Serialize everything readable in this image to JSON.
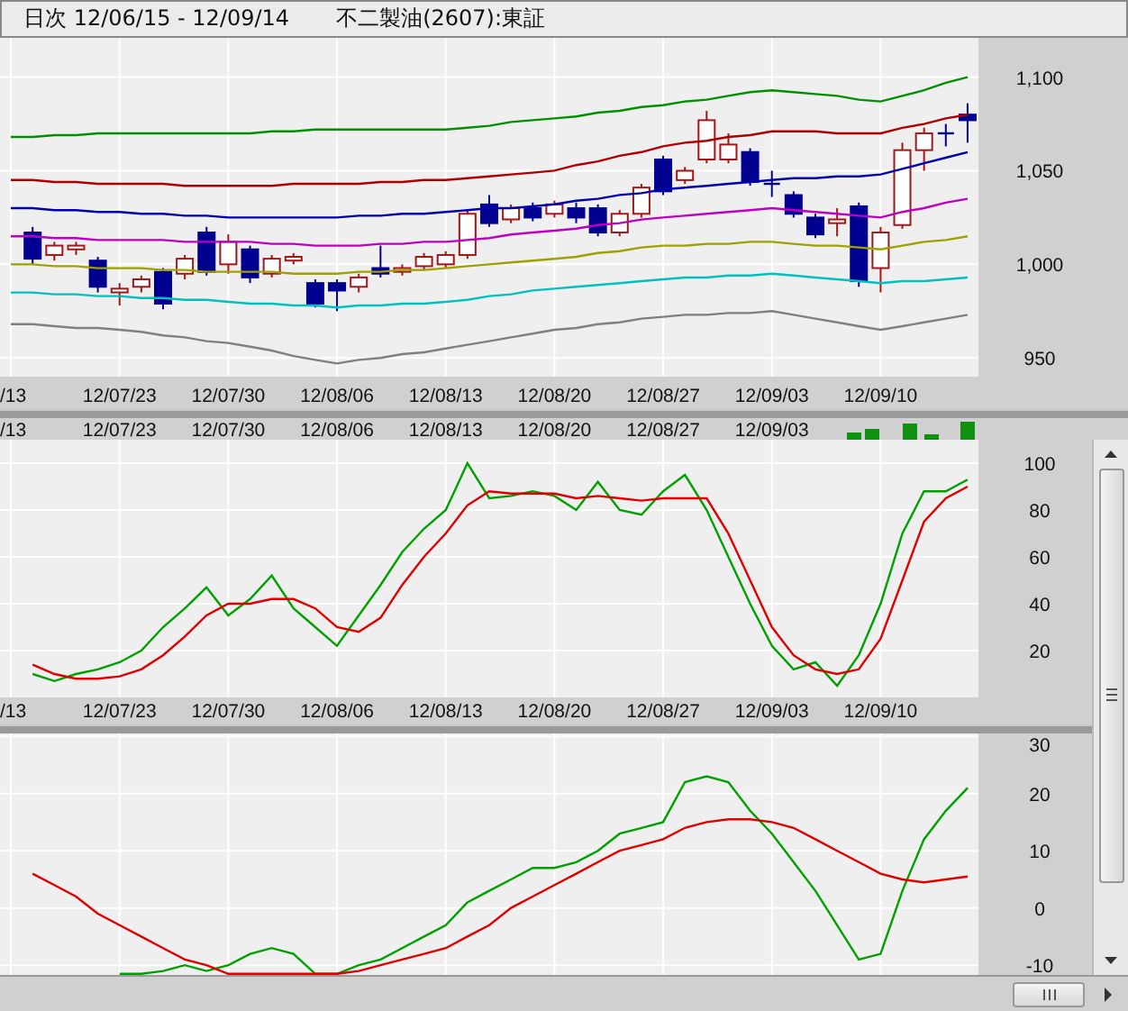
{
  "header": {
    "period": "日次 12/06/15 - 12/09/14",
    "security": "不二製油(2607):東証"
  },
  "price_panel": {
    "chart_data": {
      "type": "candlestick",
      "grid": true,
      "categories": [
        "/13",
        null,
        null,
        null,
        null,
        "12/07/23",
        null,
        null,
        null,
        null,
        "12/07/30",
        null,
        null,
        null,
        null,
        "12/08/06",
        null,
        null,
        null,
        null,
        "12/08/13",
        null,
        null,
        null,
        null,
        "12/08/20",
        null,
        null,
        null,
        null,
        "12/08/27",
        null,
        null,
        null,
        null,
        "12/09/03",
        null,
        null,
        null,
        null,
        "12/09/10",
        null,
        null,
        null,
        null
      ],
      "ylim": [
        940,
        1121
      ],
      "yticks": [
        {
          "value": 1100,
          "label": "1,100"
        },
        {
          "value": 1050,
          "label": "1,050"
        },
        {
          "value": 1000,
          "label": "1,000"
        },
        {
          "value": 950,
          "label": "950"
        }
      ],
      "ohlc": [
        null,
        [
          1017,
          1020,
          1000,
          1003
        ],
        [
          1005,
          1012,
          1002,
          1010
        ],
        [
          1008,
          1012,
          1005,
          1010
        ],
        [
          1002,
          1004,
          985,
          988
        ],
        [
          985,
          990,
          978,
          987
        ],
        [
          988,
          994,
          985,
          992
        ],
        [
          996,
          998,
          976,
          979
        ],
        [
          995,
          1005,
          992,
          1003
        ],
        [
          1017,
          1020,
          994,
          996
        ],
        [
          1000,
          1016,
          995,
          1012
        ],
        [
          1008,
          1010,
          990,
          993
        ],
        [
          995,
          1005,
          993,
          1003
        ],
        [
          1002,
          1006,
          1000,
          1004
        ],
        [
          990,
          992,
          977,
          979
        ],
        [
          990,
          992,
          975,
          986
        ],
        [
          988,
          995,
          985,
          993
        ],
        [
          998,
          1010,
          993,
          995
        ],
        [
          996,
          1000,
          994,
          998
        ],
        [
          999,
          1006,
          997,
          1004
        ],
        [
          1000,
          1007,
          998,
          1005
        ],
        [
          1005,
          1029,
          1003,
          1027
        ],
        [
          1032,
          1037,
          1020,
          1022
        ],
        [
          1024,
          1032,
          1022,
          1030
        ],
        [
          1030,
          1033,
          1023,
          1025
        ],
        [
          1027,
          1034,
          1025,
          1032
        ],
        [
          1030,
          1033,
          1022,
          1025
        ],
        [
          1030,
          1032,
          1015,
          1017
        ],
        [
          1017,
          1029,
          1015,
          1027
        ],
        [
          1027,
          1043,
          1025,
          1041
        ],
        [
          1056,
          1058,
          1037,
          1039
        ],
        [
          1045,
          1052,
          1043,
          1050
        ],
        [
          1056,
          1082,
          1054,
          1077
        ],
        [
          1056,
          1070,
          1054,
          1064
        ],
        [
          1060,
          1062,
          1042,
          1044
        ],
        [
          1043,
          1050,
          1036,
          1043
        ],
        [
          1037,
          1039,
          1025,
          1027
        ],
        [
          1025,
          1027,
          1014,
          1016
        ],
        [
          1022,
          1030,
          1015,
          1024
        ],
        [
          1031,
          1033,
          988,
          991
        ],
        [
          998,
          1020,
          985,
          1017
        ],
        [
          1021,
          1065,
          1019,
          1061
        ],
        [
          1061,
          1073,
          1050,
          1070
        ],
        [
          1070,
          1075,
          1063,
          1070
        ],
        [
          1080,
          1086,
          1065,
          1077
        ]
      ],
      "series": [
        {
          "type": "line",
          "color": "#009000",
          "values": [
            1068,
            1068,
            1069,
            1069,
            1070,
            1070,
            1070,
            1070,
            1070,
            1070,
            1070,
            1070,
            1071,
            1071,
            1072,
            1072,
            1072,
            1072,
            1072,
            1072,
            1072,
            1073,
            1074,
            1076,
            1077,
            1078,
            1079,
            1081,
            1082,
            1084,
            1085,
            1087,
            1088,
            1090,
            1092,
            1093,
            1092,
            1091,
            1090,
            1088,
            1087,
            1090,
            1093,
            1097,
            1100
          ]
        },
        {
          "type": "line",
          "color": "#b00000",
          "values": [
            1045,
            1045,
            1044,
            1044,
            1043,
            1043,
            1043,
            1043,
            1042,
            1042,
            1042,
            1042,
            1042,
            1043,
            1043,
            1043,
            1043,
            1044,
            1044,
            1045,
            1045,
            1046,
            1047,
            1048,
            1049,
            1050,
            1053,
            1055,
            1058,
            1060,
            1063,
            1065,
            1066,
            1068,
            1069,
            1071,
            1071,
            1071,
            1070,
            1070,
            1070,
            1073,
            1075,
            1078,
            1080
          ]
        },
        {
          "type": "line",
          "color": "#0000b0",
          "values": [
            1030,
            1030,
            1029,
            1029,
            1028,
            1028,
            1027,
            1027,
            1026,
            1026,
            1025,
            1025,
            1025,
            1025,
            1025,
            1025,
            1026,
            1026,
            1027,
            1027,
            1028,
            1029,
            1030,
            1030,
            1031,
            1032,
            1034,
            1035,
            1037,
            1038,
            1040,
            1041,
            1042,
            1043,
            1044,
            1045,
            1046,
            1046,
            1047,
            1047,
            1048,
            1051,
            1054,
            1057,
            1060
          ]
        },
        {
          "type": "line",
          "color": "#c000c0",
          "values": [
            1015,
            1015,
            1014,
            1014,
            1013,
            1013,
            1013,
            1013,
            1012,
            1012,
            1012,
            1012,
            1011,
            1011,
            1010,
            1010,
            1010,
            1011,
            1011,
            1012,
            1012,
            1013,
            1014,
            1016,
            1017,
            1018,
            1019,
            1021,
            1022,
            1024,
            1025,
            1026,
            1027,
            1028,
            1029,
            1030,
            1029,
            1028,
            1027,
            1026,
            1025,
            1028,
            1030,
            1033,
            1035
          ]
        },
        {
          "type": "line",
          "color": "#a0a000",
          "values": [
            1000,
            1000,
            999,
            999,
            998,
            998,
            998,
            997,
            997,
            996,
            996,
            996,
            996,
            995,
            995,
            995,
            996,
            996,
            997,
            997,
            998,
            999,
            1000,
            1001,
            1002,
            1003,
            1004,
            1006,
            1007,
            1009,
            1010,
            1010,
            1011,
            1011,
            1012,
            1012,
            1011,
            1010,
            1010,
            1009,
            1008,
            1010,
            1012,
            1013,
            1015
          ]
        },
        {
          "type": "line",
          "color": "#00c0c0",
          "values": [
            985,
            985,
            984,
            984,
            983,
            983,
            982,
            982,
            981,
            981,
            980,
            979,
            979,
            978,
            978,
            977,
            978,
            978,
            979,
            979,
            980,
            981,
            983,
            984,
            986,
            987,
            988,
            989,
            990,
            991,
            992,
            993,
            993,
            994,
            994,
            995,
            994,
            993,
            992,
            991,
            990,
            991,
            991,
            992,
            993
          ]
        },
        {
          "type": "line",
          "color": "#808080",
          "values": [
            968,
            968,
            967,
            966,
            966,
            965,
            964,
            962,
            961,
            959,
            958,
            956,
            954,
            951,
            949,
            947,
            949,
            950,
            952,
            953,
            955,
            957,
            959,
            961,
            963,
            965,
            966,
            968,
            969,
            971,
            972,
            973,
            973,
            974,
            974,
            975,
            973,
            971,
            969,
            967,
            965,
            967,
            969,
            971,
            973
          ]
        }
      ]
    }
  },
  "volume_strip": {
    "date_labels": [
      "/13",
      "12/07/23",
      "12/07/30",
      "12/08/06",
      "12/08/13",
      "12/08/20",
      "12/08/27",
      "12/09/03"
    ]
  },
  "stochastic_panel": {
    "chart_data": {
      "type": "line",
      "grid": true,
      "categories": [
        "/13",
        null,
        null,
        null,
        null,
        "12/07/23",
        null,
        null,
        null,
        null,
        "12/07/30",
        null,
        null,
        null,
        null,
        "12/08/06",
        null,
        null,
        null,
        null,
        "12/08/13",
        null,
        null,
        null,
        null,
        "12/08/20",
        null,
        null,
        null,
        null,
        "12/08/27",
        null,
        null,
        null,
        null,
        "12/09/03",
        null,
        null,
        null,
        null,
        "12/09/10",
        null,
        null,
        null,
        null
      ],
      "ylim": [
        0,
        110
      ],
      "yticks": [
        100,
        80,
        60,
        40,
        20
      ],
      "series": [
        {
          "color": "#00a000",
          "values": [
            null,
            10,
            7,
            10,
            12,
            15,
            20,
            30,
            38,
            47,
            35,
            42,
            52,
            38,
            30,
            22,
            35,
            48,
            62,
            72,
            80,
            100,
            85,
            86,
            88,
            86,
            80,
            92,
            80,
            78,
            88,
            95,
            80,
            60,
            40,
            22,
            12,
            15,
            5,
            18,
            40,
            70,
            88,
            88,
            93
          ]
        },
        {
          "color": "#e00000",
          "values": [
            null,
            14,
            10,
            8,
            8,
            9,
            12,
            18,
            26,
            35,
            40,
            40,
            42,
            42,
            38,
            30,
            28,
            34,
            48,
            60,
            70,
            82,
            88,
            87,
            87,
            87,
            85,
            86,
            85,
            84,
            85,
            85,
            85,
            70,
            50,
            30,
            18,
            12,
            10,
            12,
            25,
            50,
            75,
            85,
            90
          ]
        }
      ]
    }
  },
  "oscillator_panel": {
    "chart_data": {
      "type": "line",
      "grid": true,
      "categories": [
        null,
        null,
        null,
        null,
        null,
        null,
        null,
        null,
        null,
        null,
        null,
        null,
        null,
        null,
        null,
        null,
        null,
        null,
        null,
        null,
        null,
        null,
        null,
        null,
        null,
        null,
        null,
        null,
        null,
        null,
        null,
        null,
        null,
        null,
        null,
        null,
        null,
        null,
        null,
        null,
        null,
        null,
        null,
        null,
        null
      ],
      "ylim": [
        -11.7,
        30.5
      ],
      "yticks": [
        30,
        20,
        10,
        0,
        -10
      ],
      "series": [
        {
          "color": "#00a000",
          "values": [
            null,
            null,
            null,
            null,
            null,
            -11.5,
            -11.5,
            -11,
            -10,
            -11,
            -10,
            -8,
            -7,
            -8,
            -11.5,
            -11.5,
            -10,
            -9,
            -7,
            -5,
            -3,
            1,
            3,
            5,
            7,
            7,
            8,
            10,
            13,
            14,
            15,
            22,
            23,
            22,
            17,
            13,
            8,
            3,
            -3,
            -9,
            -8,
            3,
            12,
            17,
            21
          ]
        },
        {
          "color": "#e00000",
          "values": [
            null,
            6,
            4,
            2,
            -1,
            -3,
            -5,
            -7,
            -9,
            -10,
            -11.5,
            -11.5,
            -11.5,
            -11.5,
            -11.5,
            -11.5,
            -11,
            -10,
            -9,
            -8,
            -7,
            -5,
            -3,
            0,
            2,
            4,
            6,
            8,
            10,
            11,
            12,
            14,
            15,
            15.5,
            15.5,
            15,
            14,
            12,
            10,
            8,
            6,
            5,
            4.5,
            5,
            5.5
          ]
        }
      ]
    }
  }
}
